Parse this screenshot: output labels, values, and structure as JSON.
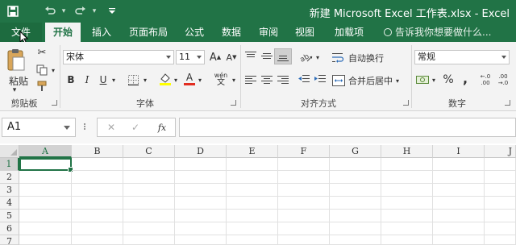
{
  "window": {
    "title": "新建 Microsoft Excel 工作表.xlsx - Excel",
    "quick_access": [
      {
        "name": "save-icon",
        "glyph": "💾"
      },
      {
        "name": "undo-icon",
        "glyph": "↶"
      },
      {
        "name": "redo-icon",
        "glyph": "↷"
      },
      {
        "name": "customize-qat-icon",
        "glyph": "▾"
      }
    ]
  },
  "tabs": [
    "文件",
    "开始",
    "插入",
    "页面布局",
    "公式",
    "数据",
    "审阅",
    "视图",
    "加载项"
  ],
  "active_tab": "开始",
  "tell_me": "告诉我你想要做什么...",
  "ribbon": {
    "clipboard": {
      "label": "剪贴板",
      "paste": "粘贴"
    },
    "font": {
      "label": "字体",
      "font_name": "宋体",
      "font_size": "11",
      "bold": "B",
      "italic": "I",
      "underline": "U",
      "grow": "A",
      "shrink": "A",
      "font_color_letter": "A",
      "phonetic": "wén",
      "font_color_accent": "#e22d20",
      "fill_color_accent": "#ffff00"
    },
    "alignment": {
      "label": "对齐方式",
      "wrap_text": "自动换行",
      "merge_center": "合并后居中"
    },
    "number": {
      "label": "数字",
      "format": "常规",
      "currency": "¥",
      "percent": "%",
      "comma": ",",
      "increase_decimal": "←.0 .00",
      "decrease_decimal": ".00 →.0"
    }
  },
  "formula_bar": {
    "name_box": "A1",
    "cancel": "✕",
    "enter": "✓",
    "function": "fx",
    "value": ""
  },
  "sheet": {
    "columns": [
      "A",
      "B",
      "C",
      "D",
      "E",
      "F",
      "G",
      "H",
      "I",
      "J"
    ],
    "rows": [
      "1",
      "2",
      "3",
      "4",
      "5",
      "6",
      "7"
    ],
    "active_cell": "A1"
  },
  "colors": {
    "brand": "#217346",
    "ribbon_bg": "#f3f3f3"
  }
}
